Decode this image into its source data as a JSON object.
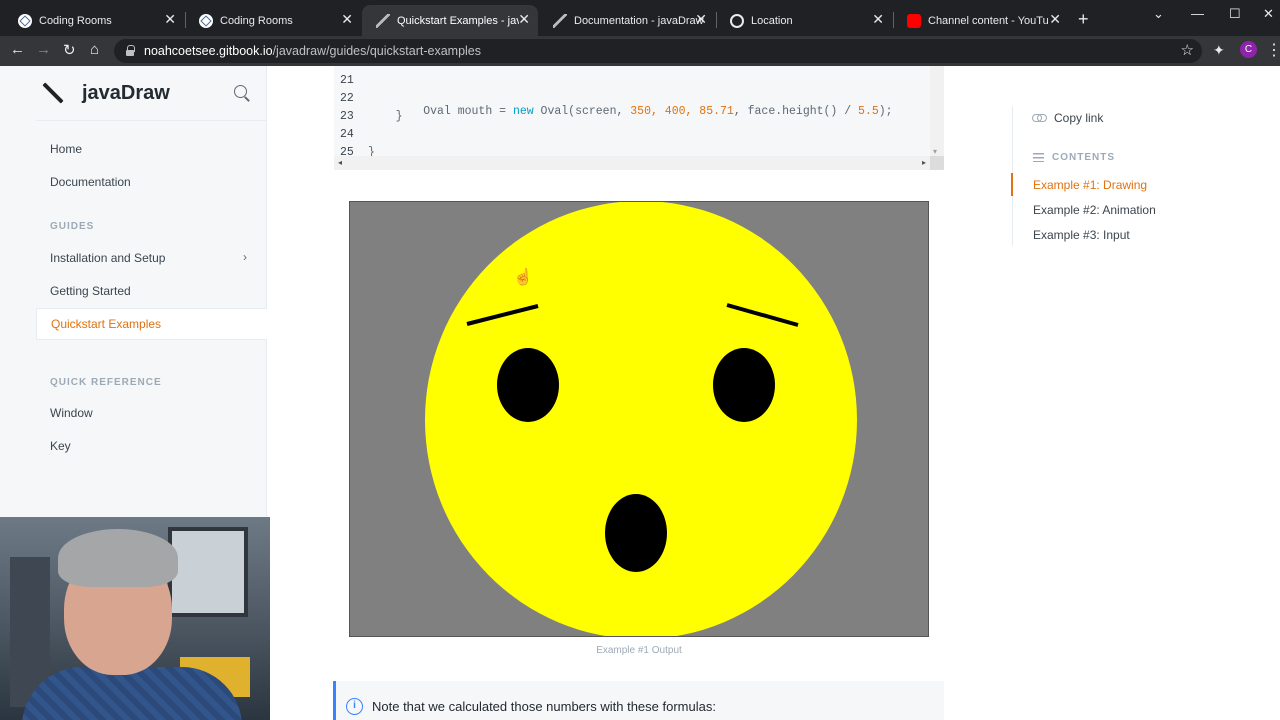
{
  "browser": {
    "tabs": [
      {
        "title": "Coding Rooms",
        "icon": "coding-rooms-icon"
      },
      {
        "title": "Coding Rooms",
        "icon": "coding-rooms-icon"
      },
      {
        "title": "Quickstart Examples - javaD",
        "icon": "javadraw-icon",
        "active": true
      },
      {
        "title": "Documentation - javaDraw",
        "icon": "javadraw-icon"
      },
      {
        "title": "Location",
        "icon": "globe-icon"
      },
      {
        "title": "Channel content - YouTube",
        "icon": "youtube-icon"
      }
    ],
    "url_host": "noahcoetsee.gitbook.io",
    "url_path": "/javadraw/guides/quickstart-examples",
    "profile_initial": "C"
  },
  "sidebar": {
    "brand": "javaDraw",
    "items": [
      {
        "label": "Home"
      },
      {
        "label": "Documentation"
      }
    ],
    "guides_heading": "GUIDES",
    "guides": [
      {
        "label": "Installation and Setup",
        "has_children": true
      },
      {
        "label": "Getting Started"
      },
      {
        "label": "Quickstart Examples",
        "active": true
      }
    ],
    "quickref_heading": "QUICK REFERENCE",
    "quickref": [
      {
        "label": "Window"
      },
      {
        "label": "Key"
      }
    ]
  },
  "code": {
    "lines": [
      {
        "n": "21",
        "text": ""
      },
      {
        "n": "22",
        "pre": "        Oval mouth = ",
        "kw": "new",
        "mid": " Oval(screen, ",
        "nums": "350, 400, 85.71",
        "post": ", face.height() / ",
        "tail": "5.5",
        "end": ");"
      },
      {
        "n": "23",
        "text": "    }"
      },
      {
        "n": "24",
        "text": ""
      },
      {
        "n": "25",
        "text": "}"
      }
    ]
  },
  "figure": {
    "caption": "Example #1 Output",
    "background": "#808080",
    "face_color": "#ffff00",
    "feature_color": "#000000"
  },
  "hint": {
    "text": "Note that we calculated those numbers with these formulas:"
  },
  "rail": {
    "copy_link": "Copy link",
    "contents_heading": "CONTENTS",
    "toc": [
      {
        "label": "Example #1: Drawing",
        "active": true
      },
      {
        "label": "Example #2: Animation"
      },
      {
        "label": "Example #3: Input"
      }
    ]
  },
  "colors": {
    "accent": "#e0720f",
    "hint_border": "#3884ff"
  }
}
